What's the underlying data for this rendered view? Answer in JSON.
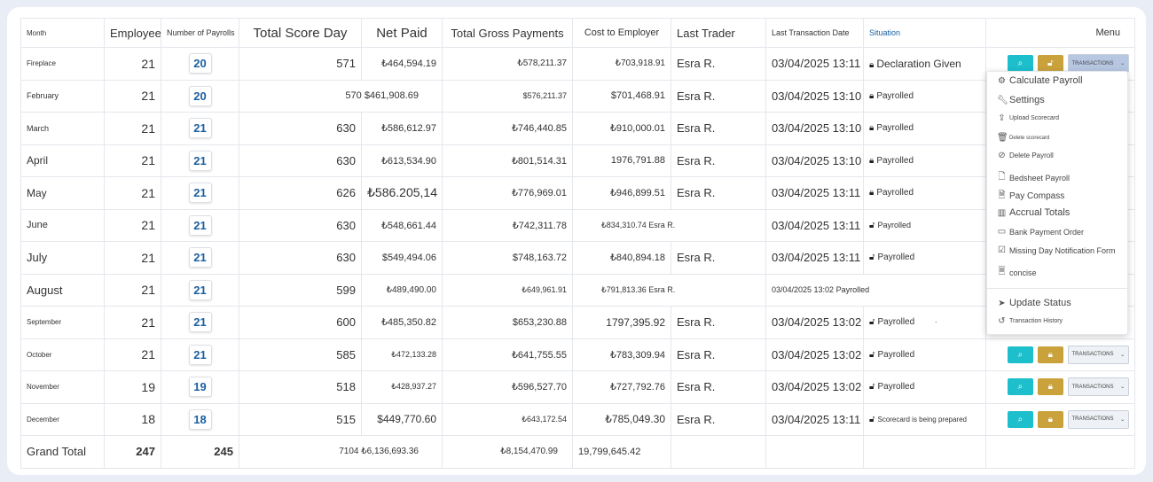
{
  "headers": {
    "month": "Month",
    "employee": "Employee",
    "num_payrolls": "Number of Payrolls",
    "total_score_day": "Total Score Day",
    "net_paid": "Net Paid",
    "total_gross": "Total Gross Payments",
    "cost_employer": "Cost to Employer",
    "last_trader": "Last Trader",
    "last_tx_date": "Last Transaction Date",
    "situation": "Situation",
    "menu": "Menu"
  },
  "rows": [
    {
      "month": "Fireplace",
      "employee": "21",
      "payrolls": "20",
      "score": "571",
      "net": "₺464,594.19",
      "gross": "₺578,211.37",
      "cost": "₺703,918.91",
      "trader": "Esra R.",
      "date": "03/04/2025 13:11",
      "status": "Declaration Given"
    },
    {
      "month": "February",
      "employee": "21",
      "payrolls": "20",
      "score": "570 $461,908.69",
      "net": "",
      "gross": "$576,211.37",
      "cost": "$701,468.91",
      "trader": "Esra R.",
      "date": "03/04/2025 13:10",
      "status": "Payrolled"
    },
    {
      "month": "March",
      "employee": "21",
      "payrolls": "21",
      "score": "630",
      "net": "₺586,612.97",
      "gross": "₺746,440.85",
      "cost": "₺910,000.01",
      "trader": "Esra R.",
      "date": "03/04/2025 13:10",
      "status": "Payrolled"
    },
    {
      "month": "April",
      "employee": "21",
      "payrolls": "21",
      "score": "630",
      "net": "₺613,534.90",
      "gross": "₺801,514.31",
      "cost": "1976,791.88",
      "trader": "Esra R.",
      "date": "03/04/2025 13:10",
      "status": "Payrolled"
    },
    {
      "month": "May",
      "employee": "21",
      "payrolls": "21",
      "score": "626",
      "net": "₺586.205,14",
      "gross": "₺776,969.01",
      "cost": "₺946,899.51",
      "trader": "Esra R.",
      "date": "03/04/2025 13:11",
      "status": "Payrolled"
    },
    {
      "month": "June",
      "employee": "21",
      "payrolls": "21",
      "score": "630",
      "net": "₺548,661.44",
      "gross": "₺742,311.78",
      "cost": "₺834,310.74 Esra R.",
      "trader": ".",
      "date": "03/04/2025 13:11",
      "status": "Payrolled"
    },
    {
      "month": "July",
      "employee": "21",
      "payrolls": "21",
      "score": "630",
      "net": "$549,494.06",
      "gross": "$748,163.72",
      "cost": "₺840,894.18",
      "trader": "Esra R.",
      "date": "03/04/2025 13:11",
      "status": "Payrolled"
    },
    {
      "month": "August",
      "employee": "21",
      "payrolls": "21",
      "score": "599",
      "net": "₺489,490.00",
      "gross": "₺649,961.91",
      "cost": "₺791,813.36 Esra R.",
      "trader": ".",
      "date": "03/04/2025 13:02 Payrolled",
      "status": ""
    },
    {
      "month": "September",
      "employee": "21",
      "payrolls": "21",
      "score": "600",
      "net": "₺485,350.82",
      "gross": "$653,230.88",
      "cost": "1797,395.92",
      "trader": "Esra R.",
      "date": "03/04/2025 13:02",
      "status": "Payrolled"
    },
    {
      "month": "October",
      "employee": "21",
      "payrolls": "21",
      "score": "585",
      "net": "₺472,133.28",
      "gross": "₺641,755.55",
      "cost": "₺783,309.94",
      "trader": "Esra R.",
      "date": "03/04/2025 13:02",
      "status": "Payrolled"
    },
    {
      "month": "November",
      "employee": "19",
      "payrolls": "19",
      "score": "518",
      "net": "₺428,937.27",
      "gross": "₺596,527.70",
      "cost": "₺727,792.76",
      "trader": "Esra R.",
      "date": "03/04/2025 13:02",
      "status": "Payrolled"
    },
    {
      "month": "December",
      "employee": "18",
      "payrolls": "18",
      "score": "515",
      "net": "$449,770.60",
      "gross": "₺643,172.54",
      "cost": "₺785,049.30",
      "trader": "Esra R.",
      "date": "03/04/2025 13:11",
      "status": "Scorecard is being prepared"
    }
  ],
  "total": {
    "label": "Grand Total",
    "employee": "247",
    "payrolls": "245",
    "score_net": "7104 ₺6,136,693.36",
    "gross": "₺8,154,470.99",
    "cost": "19,799,645.42"
  },
  "tx_label": "TRANSACTIONS",
  "dot": ".",
  "menu_items": {
    "calculate": "Calculate Payroll",
    "settings": "Settings",
    "upload": "Upload Scorecard",
    "delete_scorecard": "Delete scorecard",
    "delete_payroll": "Delete Payroll",
    "bedsheet": "Bedsheet Payroll",
    "pay_compass": "Pay Compass",
    "accrual": "Accrual Totals",
    "bank": "Bank Payment Order",
    "missing": "Missing Day Notification Form",
    "concise": "concise",
    "update": "Update Status",
    "history": "Transaction History"
  },
  "colors": {
    "teal": "#1dbfcc",
    "gold": "#c9a23c",
    "badge_text": "#1b5fa0",
    "situation_header": "#1b5fa0"
  }
}
